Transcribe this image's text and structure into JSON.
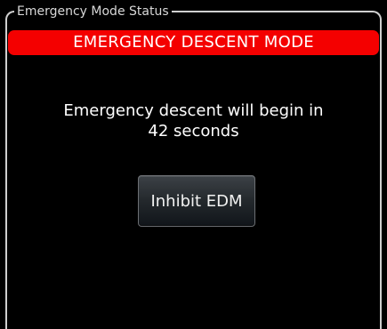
{
  "panel": {
    "title": "Emergency Mode Status"
  },
  "alert": {
    "text": "EMERGENCY DESCENT MODE",
    "color": "#f40000"
  },
  "message": {
    "line1": "Emergency descent will begin in",
    "line2": "42 seconds"
  },
  "button": {
    "label": "Inhibit EDM"
  }
}
